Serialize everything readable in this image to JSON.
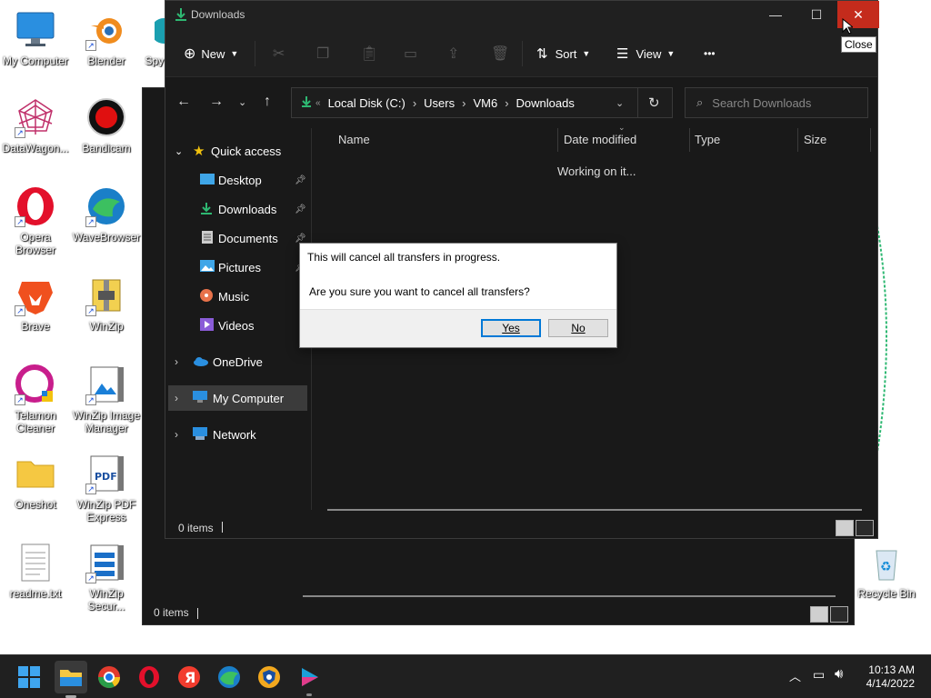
{
  "desktop": {
    "icons": [
      {
        "label": "My Computer"
      },
      {
        "label": "Blender"
      },
      {
        "label": "Spy"
      },
      {
        "label": "DataWagon..."
      },
      {
        "label": "Bandicam"
      },
      {
        "label": "Opera Browser"
      },
      {
        "label": "WaveBrowser"
      },
      {
        "label": "Brave"
      },
      {
        "label": "WinZip"
      },
      {
        "label": "Telamon Cleaner"
      },
      {
        "label": "WinZip Image Manager"
      },
      {
        "label": "Oneshot"
      },
      {
        "label": "WinZip PDF Express"
      },
      {
        "label": "readme.txt"
      },
      {
        "label": "WinZip Secur..."
      },
      {
        "label": "Recycle Bin"
      }
    ]
  },
  "back_window": {
    "status": "0 items"
  },
  "window": {
    "title": "Downloads",
    "toolbar": {
      "new_label": "New",
      "sort_label": "Sort",
      "view_label": "View",
      "more_label": "•••"
    },
    "address": {
      "crumbs": [
        "Local Disk (C:)",
        "Users",
        "VM6",
        "Downloads"
      ],
      "search_placeholder": "Search Downloads"
    },
    "sidebar": {
      "quick_access": "Quick access",
      "items": [
        "Desktop",
        "Downloads",
        "Documents",
        "Pictures",
        "Music",
        "Videos"
      ],
      "onedrive": "OneDrive",
      "my_computer": "My Computer",
      "network": "Network"
    },
    "columns": [
      "Name",
      "Date modified",
      "Type",
      "Size"
    ],
    "working_text": "Working on it...",
    "status": "0 items"
  },
  "dialog": {
    "line1": "This will cancel all transfers in progress.",
    "line2": "Are you sure you want to cancel all transfers?",
    "yes_label": "Yes",
    "no_label": "No"
  },
  "tooltip": {
    "text": "Close"
  },
  "taskbar": {
    "time": "10:13 AM",
    "date": "4/14/2022"
  },
  "colors": {
    "accent_green": "#2eb872",
    "close_red": "#c42b1c",
    "dark_bg": "#191919"
  }
}
